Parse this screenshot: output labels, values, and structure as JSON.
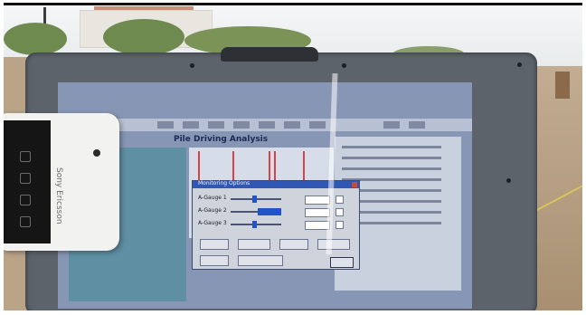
{
  "photo_subject": "rugged laptop showing pile driving analysis software outdoors",
  "screen": {
    "app_title": "Pile Driving Analysis",
    "dialog": {
      "title": "Monitoring Options",
      "rows": [
        {
          "label": "A-Gauge 1"
        },
        {
          "label": "A-Gauge 2"
        },
        {
          "label": "A-Gauge 3"
        }
      ],
      "ok_label": "OK"
    }
  },
  "phone": {
    "brand": "Sony Ericsson"
  },
  "colors": {
    "bezel": "#5d636a",
    "screen_bg": "#8796b4",
    "dialog_title": "#2f57b3",
    "phone_body": "#f2f2f0"
  },
  "icons": [
    "phone-camera-icon",
    "phone-home-icon"
  ]
}
